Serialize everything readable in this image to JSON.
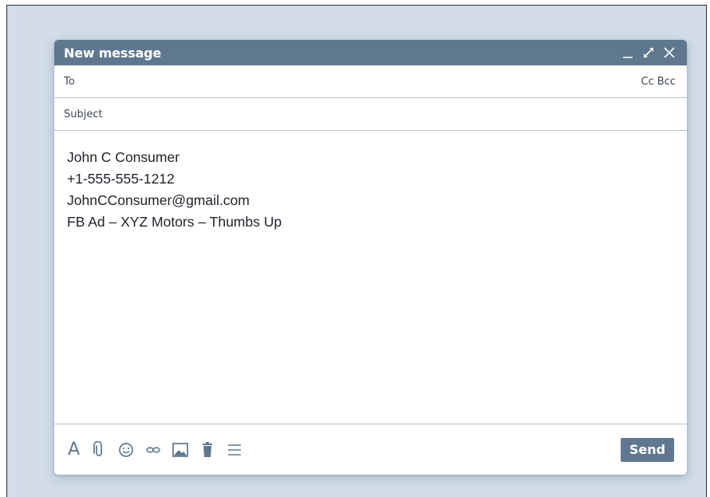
{
  "window": {
    "title": "New message"
  },
  "to_field": {
    "label": "To",
    "value": "",
    "cc_label": "Cc",
    "bcc_label": "Bcc"
  },
  "subject_field": {
    "placeholder": "Subject",
    "value": ""
  },
  "body": {
    "lines": [
      "John C Consumer",
      "+1-555-555-1212",
      "JohnCConsumer@gmail.com",
      "FB Ad – XYZ Motors – Thumbs Up"
    ]
  },
  "toolbar": {
    "format_glyph": "A",
    "send_label": "Send"
  },
  "icons": [
    "minimize-icon",
    "expand-icon",
    "close-icon",
    "text-format-icon",
    "attachment-icon",
    "emoji-icon",
    "link-icon",
    "image-icon",
    "trash-icon",
    "more-options-icon"
  ],
  "colors": {
    "accent": "#5f7890",
    "background": "#d2dde8",
    "divider": "#b7c3cf"
  }
}
